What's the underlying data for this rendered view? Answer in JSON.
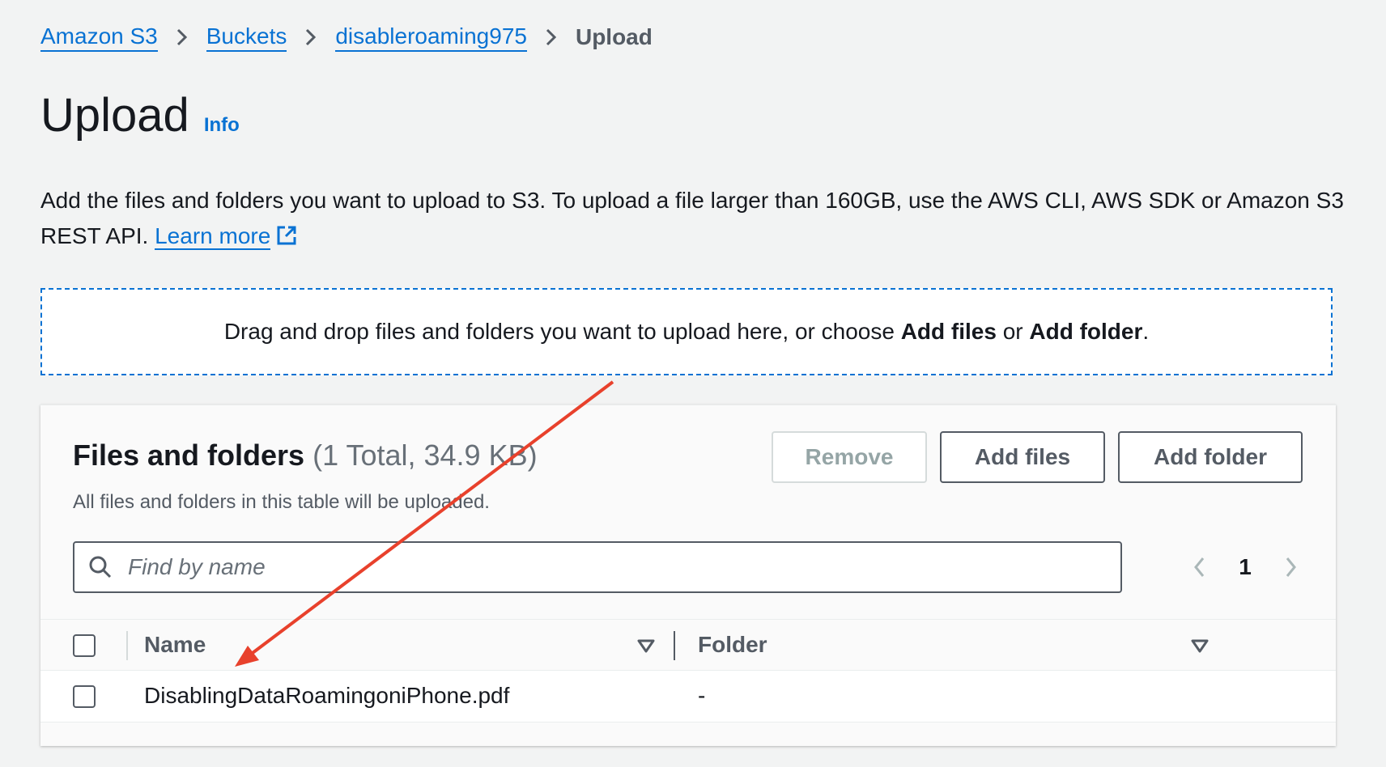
{
  "breadcrumb": {
    "items": [
      "Amazon S3",
      "Buckets",
      "disableroaming975"
    ],
    "current": "Upload"
  },
  "page": {
    "title": "Upload",
    "info_label": "Info",
    "description": "Add the files and folders you want to upload to S3. To upload a file larger than 160GB, use the AWS CLI, AWS SDK or Amazon S3 REST API.",
    "learn_more_label": "Learn more"
  },
  "dropzone": {
    "text_before": "Drag and drop files and folders you want to upload here, or choose",
    "add_files": "Add files",
    "or": "or",
    "add_folder": "Add folder",
    "text_after": "."
  },
  "files_panel": {
    "title": "Files and folders",
    "count": "(1 Total, 34.9 KB)",
    "subtitle": "All files and folders in this table will be uploaded.",
    "buttons": {
      "remove": "Remove",
      "add_files": "Add files",
      "add_folder": "Add folder"
    },
    "search": {
      "placeholder": "Find by name",
      "value": ""
    },
    "pagination": {
      "current_page": "1"
    },
    "table": {
      "columns": [
        "Name",
        "Folder"
      ],
      "rows": [
        {
          "name": "DisablingDataRoamingoniPhone.pdf",
          "folder": "-"
        }
      ]
    }
  },
  "icons": {
    "breadcrumb_separator": "chevron-right-icon",
    "external_link": "external-link-icon",
    "search": "search-icon",
    "prev_page": "chevron-left-icon",
    "next_page": "chevron-right-icon",
    "sort": "sort-down-icon"
  },
  "colors": {
    "link": "#0972d3",
    "background": "#f2f3f3",
    "annotation_arrow": "#e8412c"
  }
}
